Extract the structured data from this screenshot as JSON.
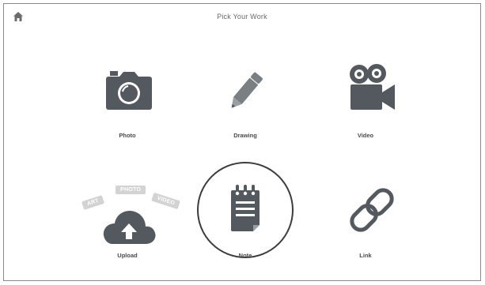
{
  "window": {
    "title": "Pick Your Work",
    "home_icon": "home-icon"
  },
  "options": {
    "photo": {
      "label": "Photo",
      "icon": "camera-icon"
    },
    "drawing": {
      "label": "Drawing",
      "icon": "pencil-icon"
    },
    "video": {
      "label": "Video",
      "icon": "video-camera-icon"
    },
    "upload": {
      "label": "Upload",
      "icon": "cloud-upload-icon",
      "tags": [
        "ART",
        "PHOTO",
        "VIDEO"
      ]
    },
    "note": {
      "label": "Note",
      "icon": "notepad-icon",
      "selected": true
    },
    "link": {
      "label": "Link",
      "icon": "chain-link-icon"
    }
  },
  "colors": {
    "icon": "#54595f",
    "tag": "#d3d3d3",
    "selection_ring": "#3c3c3c"
  }
}
